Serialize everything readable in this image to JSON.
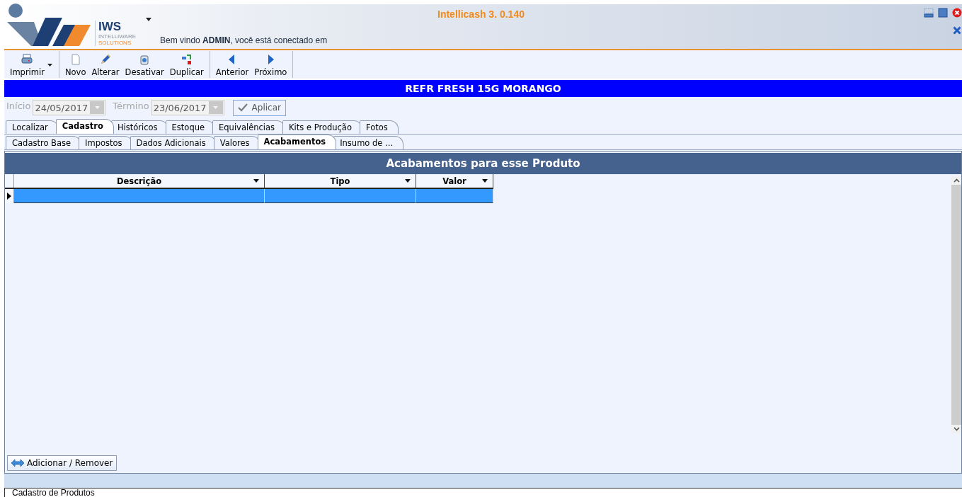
{
  "window": {
    "title": "Intellicash 3. 0.140"
  },
  "header": {
    "logo_text": "IWS",
    "logo_subtext_1": "INTELLIWARE",
    "logo_subtext_2": "SOLUTIONS",
    "welcome": "Bem vindo **ADMIN**, você está conectado em"
  },
  "toolbar": {
    "groups": [
      [
        {
          "label": "Imprimir",
          "dropdown": true
        }
      ],
      [
        {
          "label": "Novo",
          "dropdown": false
        },
        {
          "label": "Alterar",
          "dropdown": false
        },
        {
          "label": "Desativar",
          "dropdown": false
        },
        {
          "label": "Duplicar",
          "dropdown": false
        }
      ],
      [
        {
          "label": "Anterior",
          "dropdown": false
        },
        {
          "label": "Próximo",
          "dropdown": false
        }
      ]
    ]
  },
  "product_title": "REFR FRESH 15G MORANGO",
  "date_filter": {
    "fields": [
      {
        "label": "Início",
        "value": "24/05/2017",
        "disabled": true
      },
      {
        "label": "Término",
        "value": "23/06/2017",
        "disabled": true
      }
    ],
    "apply_button": "Aplicar"
  },
  "tabs": [
    {
      "label": "Localizar",
      "selected": false
    },
    {
      "label": "Cadastro",
      "selected": true
    },
    {
      "label": "Históricos",
      "selected": false
    },
    {
      "label": "Estoque",
      "selected": false
    },
    {
      "label": "Equivalências",
      "selected": false
    },
    {
      "label": "Kits e Produção",
      "selected": false
    },
    {
      "label": "Fotos",
      "selected": false
    }
  ],
  "sub_tabs": [
    {
      "label": "Cadastro Base",
      "selected": false
    },
    {
      "label": "Impostos",
      "selected": false
    },
    {
      "label": "Dados Adicionais",
      "selected": false
    },
    {
      "label": "Valores",
      "selected": false
    },
    {
      "label": "Acabamentos",
      "selected": true
    },
    {
      "label": "Insumo de ...",
      "selected": false
    }
  ],
  "panel": {
    "title": "Acabamentos para esse Produto",
    "table": {
      "columns": [
        "Descrição",
        "Tipo",
        "Valor"
      ],
      "rows": [
        {
          "selected": true
        }
      ]
    },
    "add_remove_button": "Adicionar / Remover"
  },
  "status_bar": {
    "tabs": [
      {
        "label": "Cadastro de Produtos",
        "selected": true
      }
    ]
  }
}
